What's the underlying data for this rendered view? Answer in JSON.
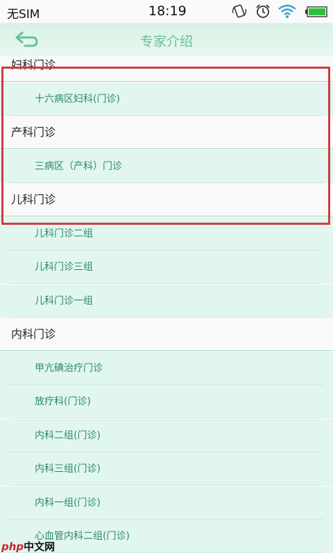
{
  "status_bar": {
    "sim": "无SIM",
    "time": "18:19",
    "icons": [
      "rotate-icon",
      "alarm-icon",
      "wifi-icon",
      "battery-icon"
    ]
  },
  "header": {
    "title": "专家介绍",
    "back_icon": "back-arrow-icon"
  },
  "list": [
    {
      "kind": "cat",
      "label": "妇科门诊"
    },
    {
      "kind": "sub",
      "label": "十六病区妇科(门诊)"
    },
    {
      "kind": "cat",
      "label": "产科门诊"
    },
    {
      "kind": "sub",
      "label": "三病区（产科）门诊"
    },
    {
      "kind": "cat",
      "label": "儿科门诊"
    },
    {
      "kind": "sub",
      "label": "儿科门诊二组"
    },
    {
      "kind": "sub",
      "label": "儿科门诊三组"
    },
    {
      "kind": "sub",
      "label": "儿科门诊一组"
    },
    {
      "kind": "cat",
      "label": "内科门诊"
    },
    {
      "kind": "sub",
      "label": "甲亢碘治疗门诊"
    },
    {
      "kind": "sub",
      "label": "放疗科(门诊)"
    },
    {
      "kind": "sub",
      "label": "内科二组(门诊)"
    },
    {
      "kind": "sub",
      "label": "内科三组(门诊)"
    },
    {
      "kind": "sub",
      "label": "内科一组(门诊)"
    },
    {
      "kind": "sub",
      "label": "心血管内科二组(门诊)"
    }
  ],
  "watermark": {
    "php": "php",
    "cn": "中文网"
  },
  "colors": {
    "accent": "#6dbf98",
    "sub_text": "#2c8a63",
    "sub_bg": "#e1f6ee",
    "highlight": "#cc3d3d"
  }
}
